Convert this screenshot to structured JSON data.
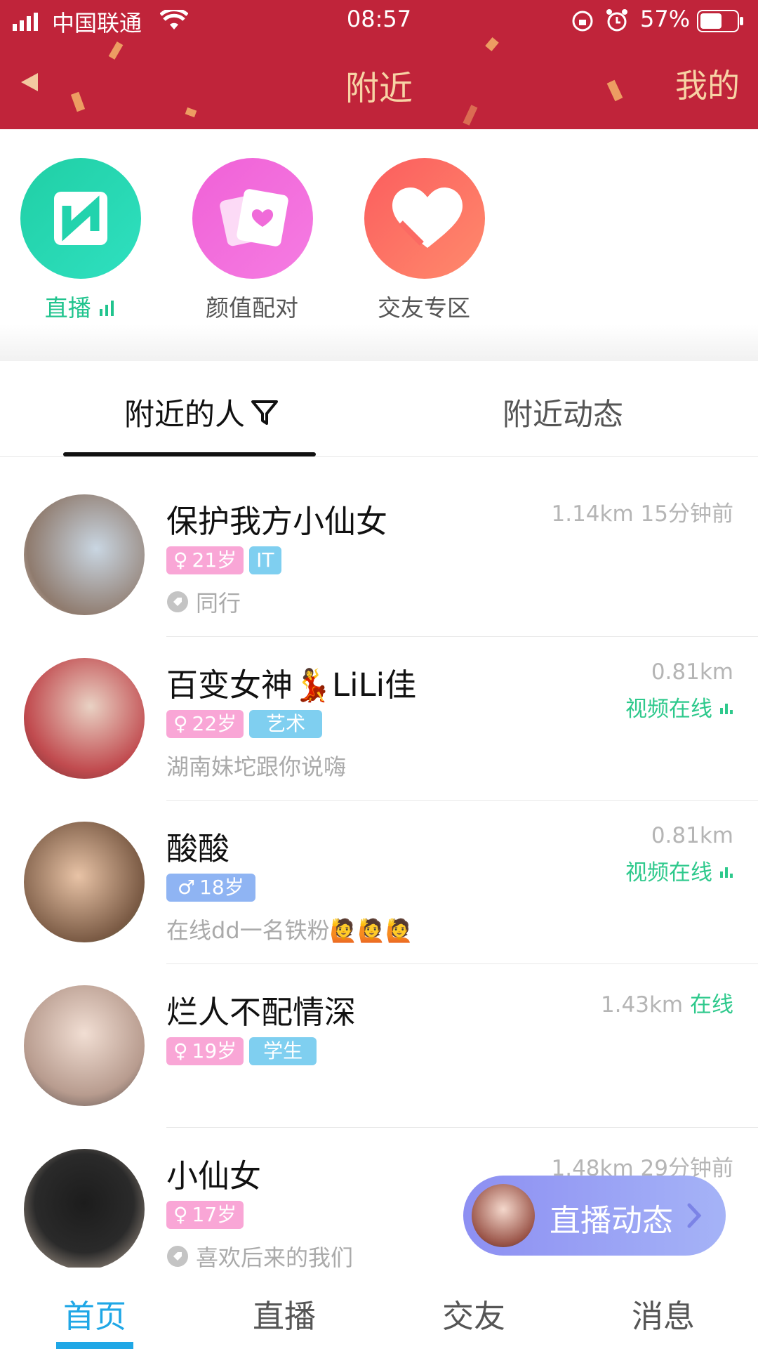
{
  "status": {
    "carrier": "中国联通",
    "time": "08:57",
    "battery": "57%"
  },
  "nav": {
    "title": "附近",
    "mine": "我的"
  },
  "entries": [
    {
      "label": "直播",
      "color": "#22d5b1"
    },
    {
      "label": "颜值配对",
      "color": "#f26fd9"
    },
    {
      "label": "交友专区",
      "color": "#fb6a63"
    }
  ],
  "tabs": [
    {
      "label": "附近的人"
    },
    {
      "label": "附近动态"
    }
  ],
  "people": [
    {
      "name": "保护我方小仙女",
      "age": "21岁",
      "tag": "IT",
      "sub": "同行",
      "dist": "1.14km",
      "time": "15分钟前"
    },
    {
      "name": "百变女神💃LiLi佳",
      "age": "22岁",
      "tag": "艺术",
      "sub": "湖南妹坨跟你说嗨",
      "dist": "0.81km",
      "status": "视频在线"
    },
    {
      "name": "酸酸",
      "age": "18岁",
      "sub": "在线dd一名铁粉🙋🙋🙋",
      "dist": "0.81km",
      "status": "视频在线"
    },
    {
      "name": "烂人不配情深",
      "age": "19岁",
      "tag": "学生",
      "dist": "1.43km",
      "status": "在线"
    },
    {
      "name": "小仙女",
      "age": "17岁",
      "sub": "喜欢后来的我们",
      "dist": "1.48km",
      "time": "29分钟前"
    }
  ],
  "live_pill": {
    "label": "直播动态"
  },
  "bottom_nav": [
    {
      "label": "首页",
      "active": true
    },
    {
      "label": "直播"
    },
    {
      "label": "交友"
    },
    {
      "label": "消息"
    }
  ]
}
